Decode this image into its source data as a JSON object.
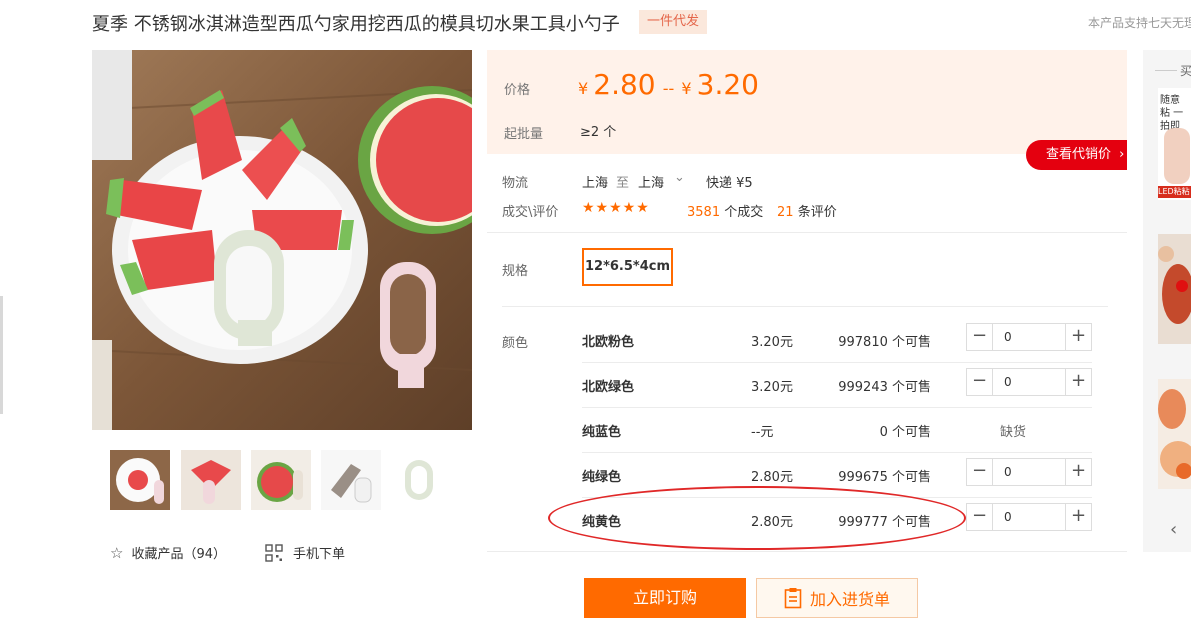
{
  "product": {
    "title": "夏季 不锈钢冰淇淋造型西瓜勺家用挖西瓜的模具切水果工具小勺子",
    "badge": "一件代发",
    "notice": "本产品支持七天无理"
  },
  "price": {
    "label": "价格",
    "currency": "¥",
    "min": "2.80",
    "separator": "--",
    "max": "3.20",
    "moq_label": "起批量",
    "moq_value": "≥2 个",
    "agent_button": "查看代销价"
  },
  "logistics": {
    "label": "物流",
    "from": "上海",
    "to_word": "至",
    "to": "上海",
    "express": "快递 ¥5"
  },
  "deals": {
    "label": "成交\\评价",
    "stars": "★★★★★",
    "deal_count": "3581",
    "deal_suffix": "个成交",
    "review_count": "21",
    "review_suffix": "条评价"
  },
  "spec": {
    "label": "规格",
    "value": "12*6.5*4cm"
  },
  "color": {
    "label": "颜色",
    "rows": [
      {
        "name": "北欧粉色",
        "price": "3.20元",
        "stock": "997810 个可售",
        "qty": "0"
      },
      {
        "name": "北欧绿色",
        "price": "3.20元",
        "stock": "999243 个可售",
        "qty": "0"
      },
      {
        "name": "纯蓝色",
        "price": "--元",
        "stock": "0 个可售",
        "status": "缺货"
      },
      {
        "name": "纯绿色",
        "price": "2.80元",
        "stock": "999675 个可售",
        "qty": "0"
      },
      {
        "name": "纯黄色",
        "price": "2.80元",
        "stock": "999777 个可售",
        "qty": "0"
      }
    ]
  },
  "actions": {
    "favorite": "收藏产品（94）",
    "mobile": "手机下单",
    "buy_now": "立即订购",
    "add_cart": "加入进货单"
  },
  "recommend": {
    "title": "买",
    "item1_text": "随意粘 一拍即",
    "item1_tag": "LED粘粘"
  },
  "colors": {
    "accent": "#ff6a00",
    "agent_red": "#e4000f",
    "highlight": "#e02828"
  }
}
